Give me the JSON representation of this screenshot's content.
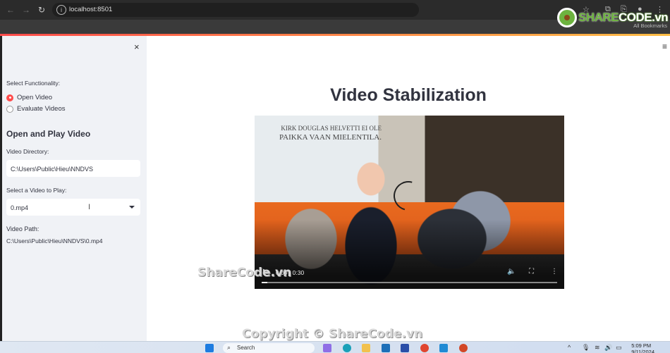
{
  "browser": {
    "url": "localhost:8501",
    "bookmarks_label": "All Bookmarks"
  },
  "watermark_logo": {
    "prefix": "SHARE",
    "suffix": "CODE.vn"
  },
  "sidebar": {
    "close_icon": "×",
    "functionality_label": "Select Functionality:",
    "options": [
      {
        "label": "Open Video",
        "selected": true
      },
      {
        "label": "Evaluate Videos",
        "selected": false
      }
    ],
    "section_title": "Open and Play Video",
    "directory_label": "Video Directory:",
    "directory_value": "C:\\Users\\Public\\Hieu\\NNDVS",
    "select_label": "Select a Video to Play:",
    "select_value": "0.mp4",
    "path_label": "Video Path:",
    "path_value": "C:\\Users\\Public\\Hieu\\NNDVS\\0.mp4"
  },
  "main": {
    "menu_icon": "≡",
    "title": "Video Stabilization",
    "video": {
      "poster_text_1": "KIRK DOUGLAS  HELVETTI EI OLE",
      "poster_text_2": "PAIKKA VAAN MIELENTILA.",
      "time": "0:00 / 0:30",
      "progress": 0
    }
  },
  "watermarks": {
    "center": "ShareCode.vn",
    "bottom": "Copyright © ShareCode.vn"
  },
  "taskbar": {
    "search_placeholder": "Search",
    "clock_time": "5:09 PM",
    "clock_date": "9/11/2024"
  }
}
